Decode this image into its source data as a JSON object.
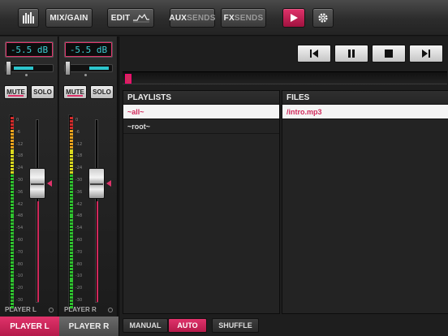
{
  "toolbar": {
    "meters_icon": "bar-meter-icon",
    "mix_gain": "MIX/GAIN",
    "edit": "EDIT",
    "aux": "AUX",
    "aux_sends": "SENDS",
    "fx": "FX",
    "fx_sends": "SENDS",
    "play_icon": "play-icon",
    "gear_icon": "gear-icon"
  },
  "strips": [
    {
      "gain": "-5.5 dB",
      "mute": "MUTE",
      "solo": "SOLO",
      "name": "PLAYER L",
      "fader_level": 0.55,
      "pan": 0.0
    },
    {
      "gain": "-5.5 dB",
      "mute": "MUTE",
      "solo": "SOLO",
      "name": "PLAYER R",
      "fader_level": 0.55,
      "pan": 0.0
    }
  ],
  "scale_labels": [
    "0",
    "-6",
    "-12",
    "-18",
    "-24",
    "-30",
    "-36",
    "-42",
    "-48",
    "-54",
    "-60",
    "-70",
    "-80",
    "-10",
    "-20",
    "-30"
  ],
  "tabs": {
    "left": "PLAYER L",
    "right": "PLAYER R"
  },
  "transport": {
    "prev_icon": "skip-previous-icon",
    "pause_icon": "pause-icon",
    "stop_icon": "stop-icon",
    "next_icon": "skip-next-icon"
  },
  "playlists": {
    "header": "PLAYLISTS",
    "items": [
      "~all~",
      "~root~"
    ]
  },
  "files": {
    "header": "FILES",
    "items": [
      "/intro.mp3"
    ]
  },
  "modes": {
    "manual": "MANUAL",
    "auto": "AUTO",
    "shuffle": "SHUFFLE"
  },
  "colors": {
    "accent": "#d12a5c",
    "cyan": "#3ecfd6"
  }
}
